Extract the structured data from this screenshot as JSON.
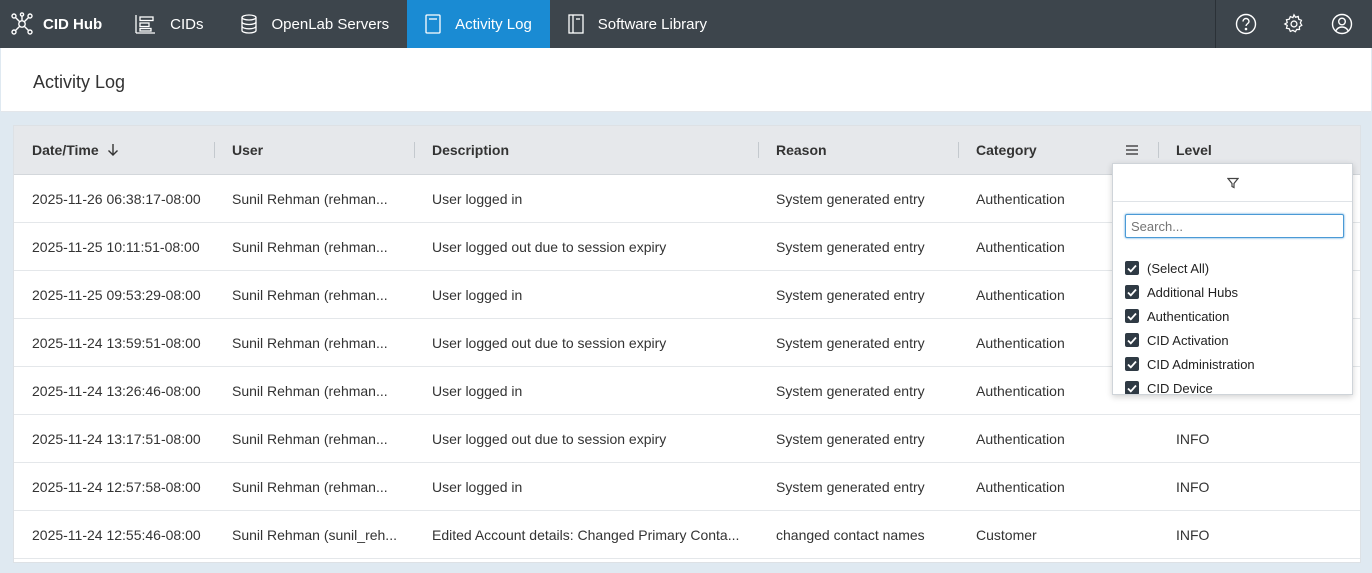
{
  "nav": {
    "brand": "CID Hub",
    "items": [
      {
        "label": "CIDs",
        "icon": "cids-icon"
      },
      {
        "label": "OpenLab Servers",
        "icon": "database-icon"
      },
      {
        "label": "Activity Log",
        "icon": "document-icon",
        "active": true
      },
      {
        "label": "Software Library",
        "icon": "book-icon"
      }
    ],
    "right_icons": [
      "help-icon",
      "gear-icon",
      "user-icon"
    ]
  },
  "page": {
    "title": "Activity Log"
  },
  "grid": {
    "columns": [
      "Date/Time",
      "User",
      "Description",
      "Reason",
      "Category",
      "Level"
    ],
    "rows": [
      [
        "2025-11-26 06:38:17-08:00",
        "Sunil Rehman (rehman...",
        "User logged in",
        "System generated entry",
        "Authentication",
        ""
      ],
      [
        "2025-11-25 10:11:51-08:00",
        "Sunil Rehman (rehman...",
        "User logged out due to session expiry",
        "System generated entry",
        "Authentication",
        ""
      ],
      [
        "2025-11-25 09:53:29-08:00",
        "Sunil Rehman (rehman...",
        "User logged in",
        "System generated entry",
        "Authentication",
        ""
      ],
      [
        "2025-11-24 13:59:51-08:00",
        "Sunil Rehman (rehman...",
        "User logged out due to session expiry",
        "System generated entry",
        "Authentication",
        ""
      ],
      [
        "2025-11-24 13:26:46-08:00",
        "Sunil Rehman (rehman...",
        "User logged in",
        "System generated entry",
        "Authentication",
        ""
      ],
      [
        "2025-11-24 13:17:51-08:00",
        "Sunil Rehman (rehman...",
        "User logged out due to session expiry",
        "System generated entry",
        "Authentication",
        "INFO"
      ],
      [
        "2025-11-24 12:57:58-08:00",
        "Sunil Rehman (rehman...",
        "User logged in",
        "System generated entry",
        "Authentication",
        "INFO"
      ],
      [
        "2025-11-24 12:55:46-08:00",
        "Sunil Rehman (sunil_reh...",
        "Edited Account details: Changed Primary Conta...",
        "changed contact names",
        "Customer",
        "INFO"
      ]
    ]
  },
  "filter_popup": {
    "search_placeholder": "Search...",
    "options": [
      "(Select All)",
      "Additional Hubs",
      "Authentication",
      "CID Activation",
      "CID Administration",
      "CID Device"
    ]
  },
  "colors": {
    "nav_bg": "#3d454c",
    "active_tab": "#1a8bd3"
  }
}
